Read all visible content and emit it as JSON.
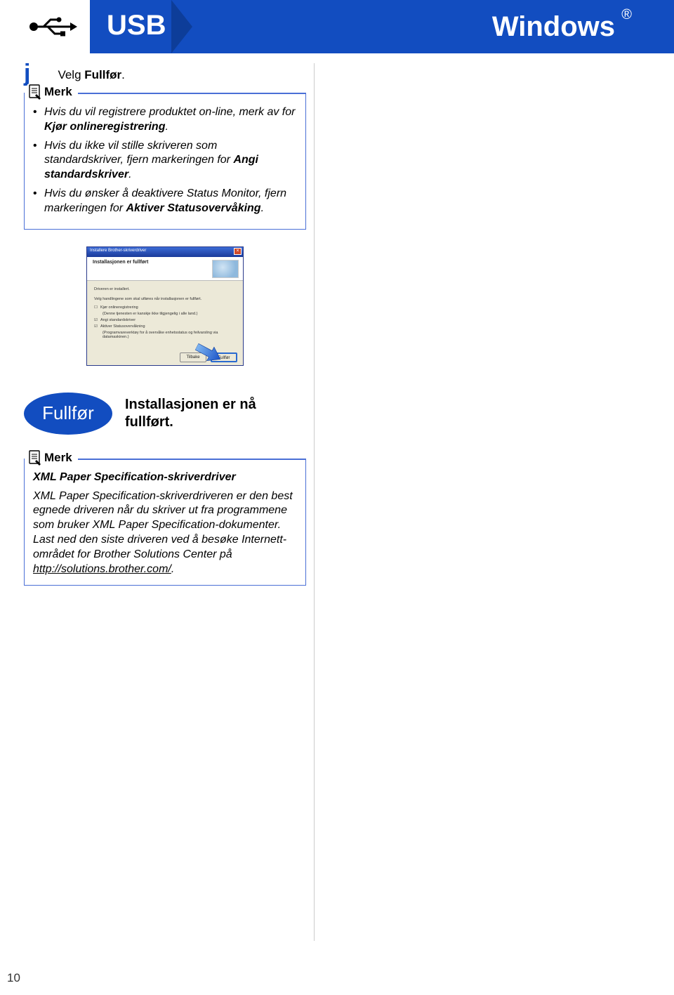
{
  "header": {
    "usb_label": "USB",
    "os_label": "Windows",
    "reg_mark": "®"
  },
  "step": {
    "letter": "j",
    "text_prefix": "Velg ",
    "text_bold": "Fullfør",
    "text_suffix": "."
  },
  "note1": {
    "label": "Merk",
    "bullets": [
      {
        "pre": "Hvis du vil registrere produktet on-line, merk av for ",
        "bold": "Kjør onlineregistrering",
        "post": "."
      },
      {
        "pre": "Hvis du ikke vil stille skriveren som standardskriver, fjern markeringen for ",
        "bold": "Angi standardskriver",
        "post": "."
      },
      {
        "pre": "Hvis du ønsker å deaktivere Status Monitor, fjern markeringen for ",
        "bold": "Aktiver Statusovervåking",
        "post": "."
      }
    ]
  },
  "screenshot": {
    "title": "Installere Brother-skriverdriver",
    "subtitle": "Installasjonen er fullført",
    "line1": "Driveren er installert.",
    "line2": "Velg handlingene som skal utføres når installasjonen er fullført.",
    "opt1": "Kjør onlineregistrering",
    "opt1_sub": "(Denne tjenesten er kanskje ikke tilgjengelig i alle land.)",
    "opt2": "Angi standardskriver",
    "opt3": "Aktiver Statusovervåkning",
    "opt3_sub": "(Programvareverktøy for å overvåke enhetsstatus og feilvarsling via datamaskinen.)",
    "btn_back": "Tilbake",
    "btn_finish": "Fullfør"
  },
  "done": {
    "badge": "Fullfør",
    "text": "Installasjonen er nå fullført."
  },
  "note2": {
    "label": "Merk",
    "title": "XML Paper Specification-skriverdriver",
    "body_pre": "XML Paper Specification-skriverdriveren er den best egnede driveren når du skriver ut fra programmene som bruker XML Paper Specification-dokumenter. Last ned den siste driveren ved å besøke Internett-området for Brother Solutions Center på ",
    "link": "http://solutions.brother.com/",
    "body_post": "."
  },
  "page_number": "10"
}
